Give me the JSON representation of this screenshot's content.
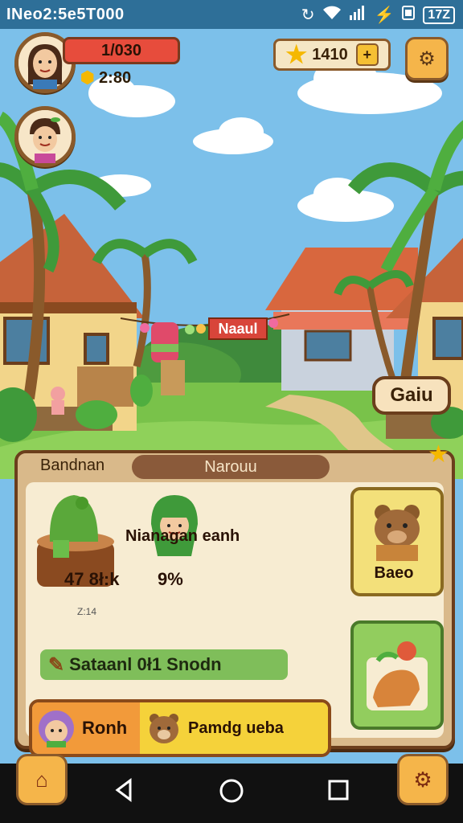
{
  "status_bar": {
    "time_text": "INeo2:5e5T000",
    "icons": [
      "sync-icon",
      "wifi-icon",
      "signal-icon",
      "charging-icon",
      "sim-icon"
    ],
    "battery_text": "17Z"
  },
  "hud": {
    "health_text": "1/030",
    "coins_text": "2:80",
    "stars_text": "1410",
    "plus_label": "+"
  },
  "scene": {
    "banner_text": "Naaul",
    "sign_label": "Gaiu"
  },
  "panel": {
    "tab_left": "Bandnan",
    "tab_active": "Narouu",
    "mission_title": "Nianagan eanh",
    "mission_stats": "47  8ł:k",
    "mission_percent": "9%",
    "small_note": "Z:14",
    "task_bar_text": "Sataanl 0ł1 Snodn",
    "card_top_label": "Baeo",
    "bottom_left_label": "Ronh",
    "bottom_right_label": "Pamdg ueba"
  },
  "colors": {
    "sky": "#7cc0ea",
    "grass": "#79c24a",
    "wood": "#6b3e1c",
    "accent_orange": "#f5b54a",
    "health_red": "#e74c3c"
  }
}
